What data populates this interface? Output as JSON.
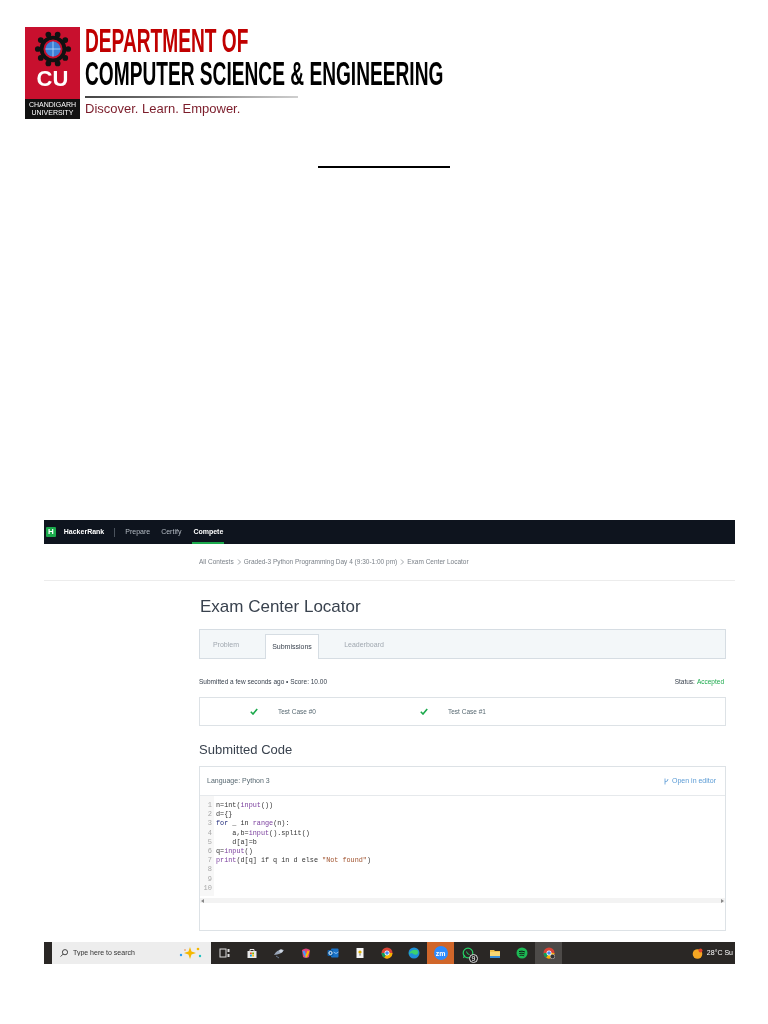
{
  "header": {
    "logo": {
      "initials": "CU",
      "caption_lines": [
        "CHANDIGARH",
        "UNIVERSITY"
      ]
    },
    "department_line": "DEPARTMENT OF",
    "department_name": "COMPUTER SCIENCE & ENGINEERING",
    "tagline": "Discover. Learn. Empower."
  },
  "hackerrank": {
    "nav": {
      "logo": "H",
      "brand": "HackerRank",
      "items": [
        {
          "label": "Prepare",
          "selected": false
        },
        {
          "label": "Certify",
          "selected": false
        },
        {
          "label": "Compete",
          "selected": true
        }
      ]
    },
    "breadcrumb": [
      "All Contests",
      "Graded-3 Python Programming Day 4 (9:30-1:00 pm)",
      "Exam Center Locator"
    ],
    "title": "Exam Center Locator",
    "tabs": [
      {
        "label": "Problem",
        "selected": false
      },
      {
        "label": "Submissions",
        "selected": true
      },
      {
        "label": "Leaderboard",
        "selected": false
      }
    ],
    "submission": {
      "summary": "Submitted a few seconds ago • Score: 10.00",
      "status_label": "Status:",
      "status": "Accepted",
      "accepted": true
    },
    "test_cases": [
      {
        "label": "Test Case #0",
        "passed": true
      },
      {
        "label": "Test Case #1",
        "passed": true
      }
    ],
    "code": {
      "heading": "Submitted Code",
      "language": "Language: Python 3",
      "open_link": "Open in editor",
      "lines": [
        {
          "number": "1",
          "tokens": [
            {
              "text": "n=int(",
              "kind": "plain"
            },
            {
              "text": "input",
              "kind": "builtin"
            },
            {
              "text": "())",
              "kind": "plain"
            }
          ]
        },
        {
          "number": "2",
          "tokens": [
            {
              "text": "d={}",
              "kind": "plain"
            }
          ]
        },
        {
          "number": "3",
          "tokens": [
            {
              "text": "for",
              "kind": "keyword"
            },
            {
              "text": " _ in ",
              "kind": "plain"
            },
            {
              "text": "range",
              "kind": "builtin"
            },
            {
              "text": "(n):",
              "kind": "plain"
            }
          ]
        },
        {
          "number": "4",
          "tokens": [
            {
              "text": "    a,b=",
              "kind": "plain"
            },
            {
              "text": "input",
              "kind": "builtin"
            },
            {
              "text": "().split()",
              "kind": "plain"
            }
          ]
        },
        {
          "number": "5",
          "tokens": [
            {
              "text": "    d[a]=b",
              "kind": "plain"
            }
          ]
        },
        {
          "number": "6",
          "tokens": [
            {
              "text": "q=",
              "kind": "plain"
            },
            {
              "text": "input",
              "kind": "builtin"
            },
            {
              "text": "()",
              "kind": "plain"
            }
          ]
        },
        {
          "number": "7",
          "tokens": [
            {
              "text": "print",
              "kind": "builtin"
            },
            {
              "text": "(d[q] if q in d else ",
              "kind": "plain"
            },
            {
              "text": "\"Not found\"",
              "kind": "string"
            },
            {
              "text": ")",
              "kind": "plain"
            }
          ]
        },
        {
          "number": "8"
        },
        {
          "number": "9"
        },
        {
          "number": "10"
        }
      ]
    }
  },
  "taskbar": {
    "search": {
      "placeholder": "Type here to search"
    },
    "apps": [
      {
        "kind": "task_view",
        "flashing": false,
        "active": false
      },
      {
        "kind": "store",
        "flashing": false,
        "active": false
      },
      {
        "kind": "feather",
        "flashing": false,
        "active": false
      },
      {
        "kind": "shield",
        "flashing": false,
        "active": false
      },
      {
        "kind": "mail",
        "flashing": false,
        "active": false
      },
      {
        "kind": "document",
        "flashing": false,
        "active": false
      },
      {
        "kind": "browser",
        "flashing": false,
        "active": false
      },
      {
        "kind": "globe",
        "flashing": false,
        "active": false
      },
      {
        "kind": "text_logo",
        "label": "zm",
        "flashing": true,
        "active": false
      },
      {
        "kind": "chat",
        "badge": "9",
        "flashing": false,
        "active": false
      },
      {
        "kind": "folder",
        "flashing": false,
        "active": false
      },
      {
        "kind": "stripes",
        "flashing": false,
        "active": false
      },
      {
        "kind": "browser_profile",
        "flashing": false,
        "active": true
      }
    ],
    "weather": "28°C Su"
  }
}
